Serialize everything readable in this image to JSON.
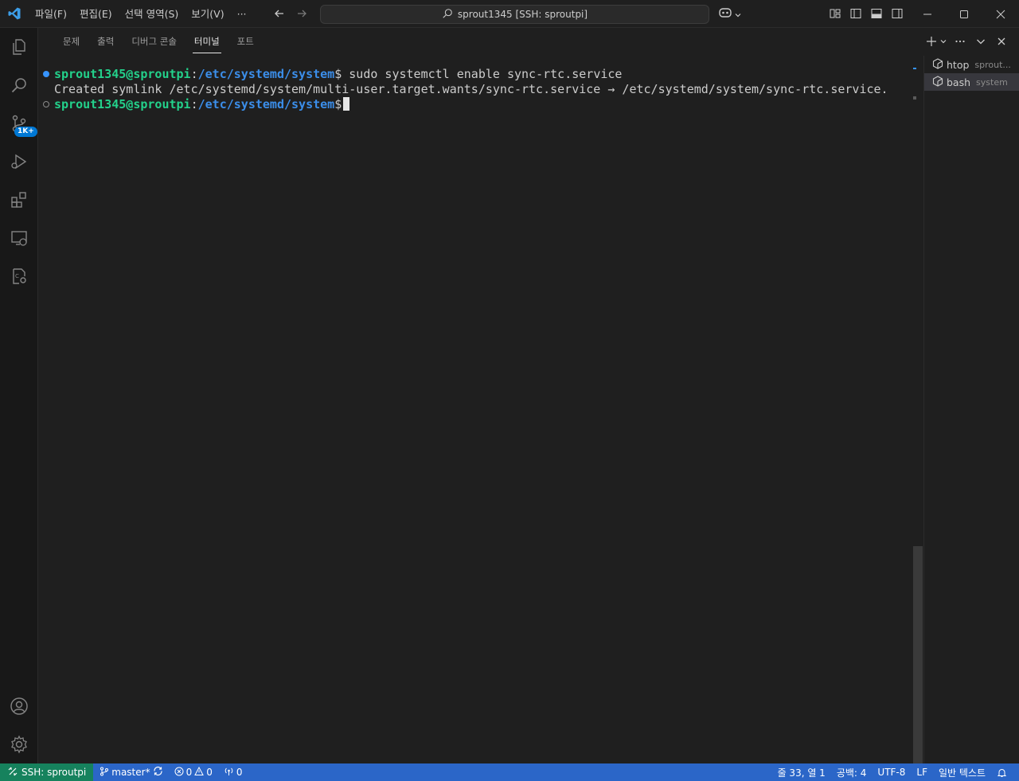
{
  "titlebar": {
    "menu": [
      "파일(F)",
      "편집(E)",
      "선택 영역(S)",
      "보기(V)",
      "···"
    ],
    "search_text": "sprout1345 [SSH: sproutpi]"
  },
  "activitybar": {
    "scm_badge": "1K+"
  },
  "panel": {
    "tabs": [
      "문제",
      "출력",
      "디버그 콘솔",
      "터미널",
      "포트"
    ],
    "active_tab": "터미널"
  },
  "terminal": {
    "line1": {
      "user": "sprout1345@sproutpi",
      "colon": ":",
      "path": "/etc/systemd/system",
      "dollar": "$",
      "command": " sudo systemctl enable sync-rtc.service"
    },
    "line2": "Created symlink /etc/systemd/system/multi-user.target.wants/sync-rtc.service → /etc/systemd/system/sync-rtc.service.",
    "line3": {
      "user": "sprout1345@sproutpi",
      "colon": ":",
      "path": "/etc/systemd/system",
      "dollar": "$"
    }
  },
  "terminal_list": [
    {
      "name": "htop",
      "desc": "sprout..."
    },
    {
      "name": "bash",
      "desc": "system"
    }
  ],
  "statusbar": {
    "remote": "SSH: sproutpi",
    "branch": "master*",
    "errors": "0",
    "warnings": "0",
    "ports": "0",
    "position": "줄 33, 열 1",
    "spaces": "공백: 4",
    "encoding": "UTF-8",
    "eol": "LF",
    "language": "일반 텍스트"
  },
  "colors": {
    "accent": "#0078d4",
    "statusbar": "#2b66c8",
    "remote": "#16825d",
    "prompt_user": "#23d18b",
    "prompt_path": "#3b8eea"
  }
}
